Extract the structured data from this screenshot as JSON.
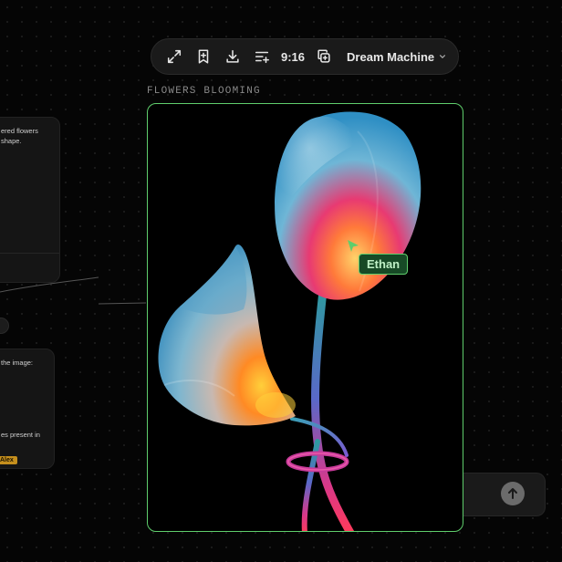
{
  "toolbar": {
    "ratio": "9:16",
    "model": "Dream Machine",
    "icons": [
      "expand-icon",
      "bookmark-add-icon",
      "download-icon",
      "adjust-icon",
      "duplicate-icon",
      "chevron-down-icon"
    ]
  },
  "card": {
    "title": "FLOWERS BLOOMING",
    "border_color": "#5fce6c"
  },
  "collaborators": [
    {
      "name": "Ethan",
      "color": "#5fce6c"
    },
    {
      "name": "Alex",
      "color": "#c58f1d"
    }
  ],
  "left_panels": {
    "panel1": {
      "line1": "ered flowers",
      "line2": "shape."
    },
    "panel2": {
      "line1": "the image:",
      "line2": "es present in"
    }
  },
  "prompt": {
    "send_icon": "arrow-up-icon"
  }
}
